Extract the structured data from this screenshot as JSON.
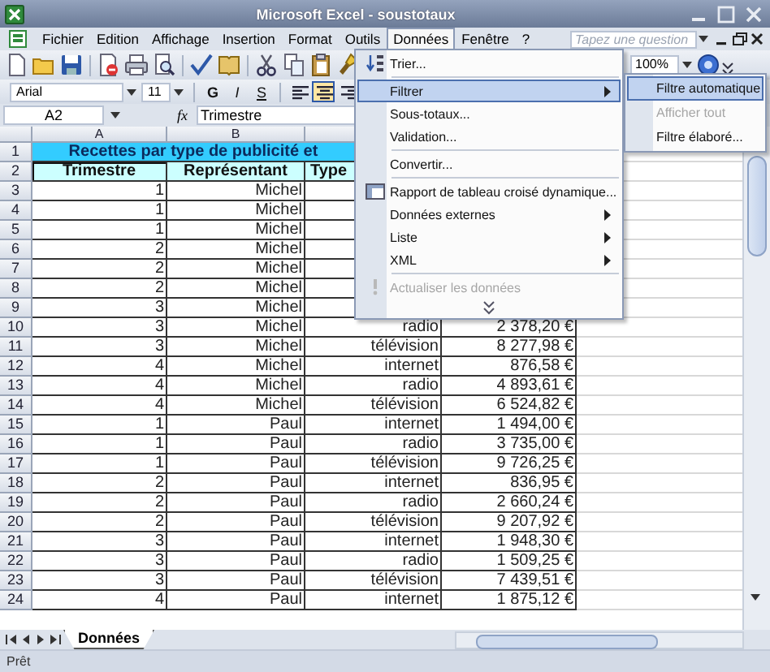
{
  "window": {
    "title": "Microsoft Excel - soustotaux"
  },
  "menu_bar": {
    "items": [
      {
        "label": "Fichier",
        "selected": false
      },
      {
        "label": "Edition",
        "selected": false
      },
      {
        "label": "Affichage",
        "selected": false
      },
      {
        "label": "Insertion",
        "selected": false
      },
      {
        "label": "Format",
        "selected": false
      },
      {
        "label": "Outils",
        "selected": false
      },
      {
        "label": "Données",
        "selected": true
      },
      {
        "label": "Fenêtre",
        "selected": false
      },
      {
        "label": "?",
        "selected": false
      }
    ],
    "question_box": {
      "placeholder": "Tapez une question"
    }
  },
  "standard_toolbar": {
    "zoom": "100%"
  },
  "formatting_toolbar": {
    "font": "Arial",
    "size": "11",
    "styles": [
      {
        "label": "G"
      },
      {
        "label": "I"
      },
      {
        "label": "S"
      }
    ],
    "alignments": [
      {
        "selected": false
      },
      {
        "selected": true
      },
      {
        "selected": false
      }
    ]
  },
  "formula_bar": {
    "name_box": "A2",
    "function_label": "fx",
    "content": "Trimestre"
  },
  "sheet": {
    "columns": [
      "A",
      "B"
    ],
    "title": {
      "row": "1",
      "text": "Recettes par type de publicité et"
    },
    "header_row": {
      "row": "2",
      "cells": [
        {
          "text": "Trimestre",
          "selected": true
        },
        {
          "text": "Représentant",
          "selected": false
        },
        {
          "text": "Type",
          "selected": false
        }
      ]
    },
    "rows": [
      {
        "row": "3",
        "cells": [
          "1",
          "Michel"
        ]
      },
      {
        "row": "4",
        "cells": [
          "1",
          "Michel"
        ]
      },
      {
        "row": "5",
        "cells": [
          "1",
          "Michel"
        ]
      },
      {
        "row": "6",
        "cells": [
          "2",
          "Michel"
        ]
      },
      {
        "row": "7",
        "cells": [
          "2",
          "Michel"
        ]
      },
      {
        "row": "8",
        "cells": [
          "2",
          "Michel"
        ]
      },
      {
        "row": "9",
        "cells": [
          "3",
          "Michel"
        ]
      },
      {
        "row": "10",
        "cells": [
          "3",
          "Michel",
          "radio",
          "2 378,20 €"
        ]
      },
      {
        "row": "11",
        "cells": [
          "3",
          "Michel",
          "télévision",
          "8 277,98 €"
        ]
      },
      {
        "row": "12",
        "cells": [
          "4",
          "Michel",
          "internet",
          "876,58 €"
        ]
      },
      {
        "row": "13",
        "cells": [
          "4",
          "Michel",
          "radio",
          "4 893,61 €"
        ]
      },
      {
        "row": "14",
        "cells": [
          "4",
          "Michel",
          "télévision",
          "6 524,82 €"
        ]
      },
      {
        "row": "15",
        "cells": [
          "1",
          "Paul",
          "internet",
          "1 494,00 €"
        ]
      },
      {
        "row": "16",
        "cells": [
          "1",
          "Paul",
          "radio",
          "3 735,00 €"
        ]
      },
      {
        "row": "17",
        "cells": [
          "1",
          "Paul",
          "télévision",
          "9 726,25 €"
        ]
      },
      {
        "row": "18",
        "cells": [
          "2",
          "Paul",
          "internet",
          "836,95 €"
        ]
      },
      {
        "row": "19",
        "cells": [
          "2",
          "Paul",
          "radio",
          "2 660,24 €"
        ]
      },
      {
        "row": "20",
        "cells": [
          "2",
          "Paul",
          "télévision",
          "9 207,92 €"
        ]
      },
      {
        "row": "21",
        "cells": [
          "3",
          "Paul",
          "internet",
          "1 948,30 €"
        ]
      },
      {
        "row": "22",
        "cells": [
          "3",
          "Paul",
          "radio",
          "1 509,25 €"
        ]
      },
      {
        "row": "23",
        "cells": [
          "3",
          "Paul",
          "télévision",
          "7 439,51 €"
        ]
      },
      {
        "row": "24",
        "cells": [
          "4",
          "Paul",
          "internet",
          "1 875,12 €"
        ]
      }
    ]
  },
  "data_menu": {
    "items": [
      {
        "kind": "item",
        "label": "Trier...",
        "selected": false,
        "disabled": false
      },
      {
        "kind": "separator"
      },
      {
        "kind": "submenu",
        "label": "Filtrer",
        "selected": true,
        "disabled": false
      },
      {
        "kind": "item",
        "label": "Sous-totaux...",
        "selected": false,
        "disabled": false
      },
      {
        "kind": "item",
        "label": "Validation...",
        "selected": false,
        "disabled": false
      },
      {
        "kind": "separator"
      },
      {
        "kind": "item",
        "label": "Convertir...",
        "selected": false,
        "disabled": false
      },
      {
        "kind": "separator"
      },
      {
        "kind": "item",
        "label": "Rapport de tableau croisé dynamique...",
        "selected": false,
        "disabled": false
      },
      {
        "kind": "submenu",
        "label": "Données externes",
        "selected": false,
        "disabled": false
      },
      {
        "kind": "submenu",
        "label": "Liste",
        "selected": false,
        "disabled": false
      },
      {
        "kind": "submenu",
        "label": "XML",
        "selected": false,
        "disabled": false
      },
      {
        "kind": "separator"
      },
      {
        "kind": "item",
        "label": "Actualiser les données",
        "selected": false,
        "disabled": true
      },
      {
        "kind": "more"
      }
    ]
  },
  "filter_submenu": {
    "items": [
      {
        "label": "Filtre automatique",
        "selected": true,
        "disabled": false
      },
      {
        "label": "Afficher tout",
        "selected": false,
        "disabled": true
      },
      {
        "label": "Filtre élaboré...",
        "selected": false,
        "disabled": false
      }
    ]
  },
  "sheet_tabs": [
    {
      "label": "Données",
      "selected": true
    }
  ],
  "status_bar": {
    "text": "Prêt"
  }
}
